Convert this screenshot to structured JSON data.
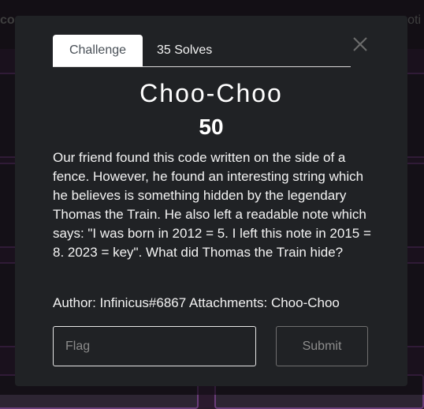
{
  "background": {
    "nav_left": "co",
    "nav_right": "oti"
  },
  "modal": {
    "tabs": [
      {
        "label": "Challenge"
      },
      {
        "label": "35 Solves"
      }
    ],
    "title": "Choo-Choo",
    "points": "50",
    "description": "Our friend found this code written on the side of a fence. However, he found an interesting string which he believes is something hidden by the legendary Thomas the Train. He also left a readable note which says: \"I was born in 2012 = 5. I left this note in 2015 = 8. 2023 = key\". What did Thomas the Train hide?",
    "author_label": "Author:",
    "author": "Infinicus#6867",
    "attachments_label": "Attachments:",
    "attachment": "Choo-Choo",
    "flag_placeholder": "Flag",
    "submit_label": "Submit",
    "close_icon": "close-icon"
  }
}
